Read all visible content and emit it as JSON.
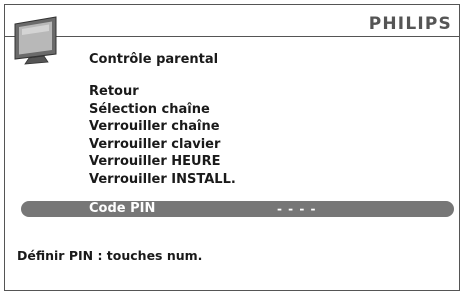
{
  "brand": "PHILIPS",
  "icon": "tv-icon",
  "menu": {
    "title": "Contrôle parental",
    "items": [
      "Retour",
      "Sélection chaîne",
      "Verrouiller chaîne",
      "Verrouiller clavier",
      "Verrouiller HEURE",
      "Verrouiller INSTALL."
    ],
    "selected": {
      "label": "Code PIN",
      "value": "- - - -"
    }
  },
  "hint": "Définir PIN : touches num.",
  "colors": {
    "frame": "#555555",
    "highlight": "#777777",
    "text": "#1a1a1a",
    "brand": "#555555"
  }
}
